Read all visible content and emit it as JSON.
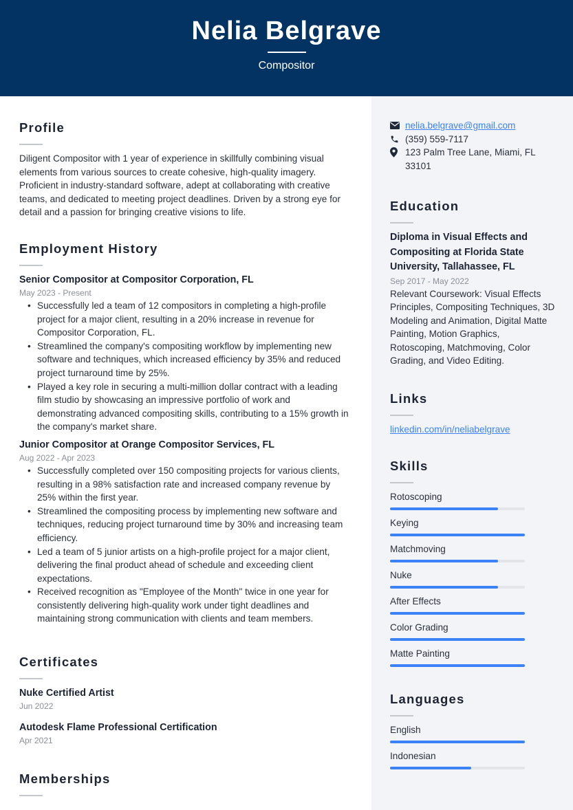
{
  "header": {
    "name": "Nelia Belgrave",
    "title": "Compositor"
  },
  "contact": {
    "email": "nelia.belgrave@gmail.com",
    "phone": "(359) 559-7117",
    "address": "123 Palm Tree Lane, Miami, FL 33101",
    "icons": [
      "envelope-icon",
      "phone-icon",
      "map-pin-icon"
    ]
  },
  "profile": {
    "heading": "Profile",
    "text": "Diligent Compositor with 1 year of experience in skillfully combining visual elements from various sources to create cohesive, high-quality imagery. Proficient in industry-standard software, adept at collaborating with creative teams, and dedicated to meeting project deadlines. Driven by a strong eye for detail and a passion for bringing creative visions to life."
  },
  "employment": {
    "heading": "Employment History",
    "jobs": [
      {
        "title": "Senior Compositor at Compositor Corporation, FL",
        "dates": "May 2023 - Present",
        "bullets": [
          "Successfully led a team of 12 compositors in completing a high-profile project for a major client, resulting in a 20% increase in revenue for Compositor Corporation, FL.",
          "Streamlined the company's compositing workflow by implementing new software and techniques, which increased efficiency by 35% and reduced project turnaround time by 25%.",
          "Played a key role in securing a multi-million dollar contract with a leading film studio by showcasing an impressive portfolio of work and demonstrating advanced compositing skills, contributing to a 15% growth in the company's market share."
        ]
      },
      {
        "title": "Junior Compositor at Orange Compositor Services, FL",
        "dates": "Aug 2022 - Apr 2023",
        "bullets": [
          "Successfully completed over 150 compositing projects for various clients, resulting in a 98% satisfaction rate and increased company revenue by 25% within the first year.",
          "Streamlined the compositing process by implementing new software and techniques, reducing project turnaround time by 30% and increasing team efficiency.",
          "Led a team of 5 junior artists on a high-profile project for a major client, delivering the final product ahead of schedule and exceeding client expectations.",
          "Received recognition as \"Employee of the Month\" twice in one year for consistently delivering high-quality work under tight deadlines and maintaining strong communication with clients and team members."
        ]
      }
    ]
  },
  "certificates": {
    "heading": "Certificates",
    "items": [
      {
        "name": "Nuke Certified Artist",
        "date": "Jun 2022"
      },
      {
        "name": "Autodesk Flame Professional Certification",
        "date": "Apr 2021"
      }
    ]
  },
  "memberships": {
    "heading": "Memberships"
  },
  "education": {
    "heading": "Education",
    "degree": "Diploma in Visual Effects and Compositing at Florida State University, Tallahassee, FL",
    "dates": "Sep 2017 - May 2022",
    "description": "Relevant Coursework: Visual Effects Principles, Compositing Techniques, 3D Modeling and Animation, Digital Matte Painting, Motion Graphics, Rotoscoping, Matchmoving, Color Grading, and Video Editing."
  },
  "links": {
    "heading": "Links",
    "items": [
      "linkedin.com/in/neliabelgrave"
    ]
  },
  "skills": {
    "heading": "Skills",
    "items": [
      {
        "name": "Rotoscoping",
        "level": 0.8
      },
      {
        "name": "Keying",
        "level": 1.0
      },
      {
        "name": "Matchmoving",
        "level": 0.8
      },
      {
        "name": "Nuke",
        "level": 0.8
      },
      {
        "name": "After Effects",
        "level": 1.0
      },
      {
        "name": "Color Grading",
        "level": 1.0
      },
      {
        "name": "Matte Painting",
        "level": 1.0
      }
    ]
  },
  "languages": {
    "heading": "Languages",
    "items": [
      {
        "name": "English",
        "level": 1.0
      },
      {
        "name": "Indonesian",
        "level": 0.6
      }
    ]
  },
  "colors": {
    "header_bg": "#023363",
    "sidebar_bg": "#f2f4f7",
    "accent": "#3b82f6"
  }
}
